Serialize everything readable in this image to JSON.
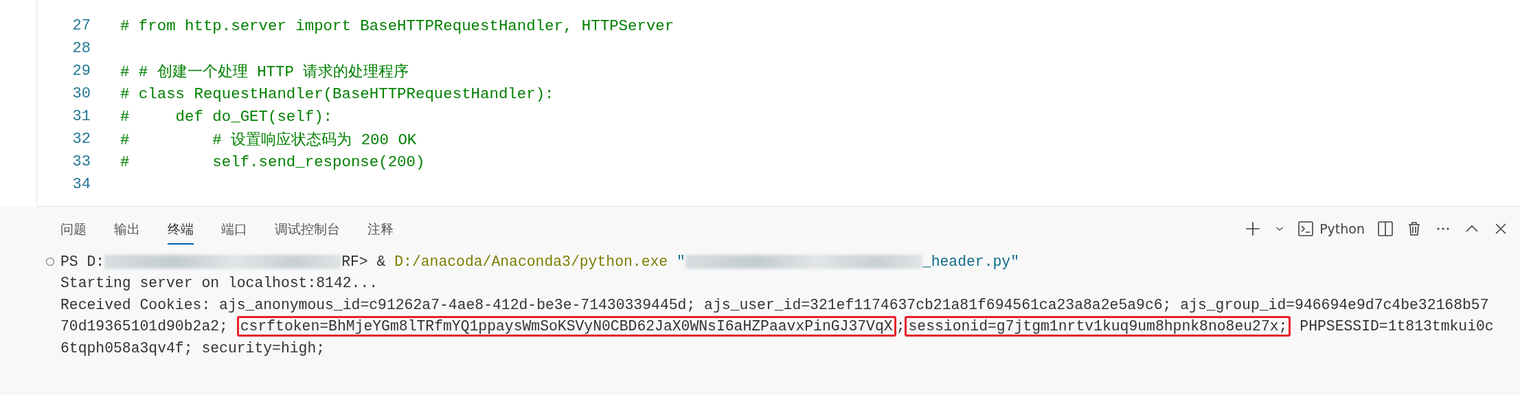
{
  "editor": {
    "lines": [
      {
        "number": "27",
        "text": "# from http.server import BaseHTTPRequestHandler, HTTPServer"
      },
      {
        "number": "28"
      },
      {
        "number": "29",
        "text": "# # 创建一个处理 HTTP 请求的处理程序"
      },
      {
        "number": "30",
        "text": "# class RequestHandler(BaseHTTPRequestHandler):"
      },
      {
        "number": "31",
        "text": "#     def do_GET(self):"
      },
      {
        "number": "32",
        "text": "#         # 设置响应状态码为 200 OK"
      },
      {
        "number": "33",
        "text": "#         self.send_response(200)"
      },
      {
        "number": "34"
      }
    ]
  },
  "panel": {
    "tabs": [
      {
        "label": "问题",
        "selected": false
      },
      {
        "label": "输出",
        "selected": false
      },
      {
        "label": "终端",
        "selected": true
      },
      {
        "label": "端口",
        "selected": false
      },
      {
        "label": "调试控制台",
        "selected": false
      },
      {
        "label": "注释",
        "selected": false
      }
    ],
    "terminal_profile": "Python"
  },
  "terminal": {
    "lines": [
      {
        "kind": "command",
        "segments": [
          {
            "kind": "plain",
            "text": "PS D:"
          },
          {
            "kind": "redacted"
          },
          {
            "kind": "plain",
            "text": "RF> & "
          },
          {
            "kind": "path",
            "text": "D:/anacoda/Anaconda3/python.exe"
          },
          {
            "kind": "string",
            "text": " \""
          },
          {
            "kind": "redacted"
          },
          {
            "kind": "string",
            "text": "_header.py\""
          }
        ]
      },
      {
        "kind": "output",
        "segments": [
          {
            "kind": "plain",
            "text": "Starting server on localhost:8142..."
          }
        ]
      },
      {
        "kind": "output",
        "segments": [
          {
            "kind": "plain",
            "text": "Received Cookies: ajs_anonymous_id=c91262a7-4ae8-412d-be3e-71430339445d; ajs_user_id=321ef1174637cb21a81f694561ca23a8a2e5a9c6; ajs_group_id=946694e9d7c4be32168b57"
          }
        ]
      },
      {
        "kind": "output",
        "segments": [
          {
            "kind": "plain",
            "text": "70d19365101d90b2a2; "
          },
          {
            "kind": "highlight",
            "text": "csrftoken=BhMjeYGm8lTRfmYQ1ppaysWmSoKSVyN0CBD62JaX0WNsI6aHZPaavxPinGJ37VqX"
          },
          {
            "kind": "plain",
            "text": ";"
          },
          {
            "kind": "highlight",
            "text": "sessionid=g7jtgm1nrtv1kuq9um8hpnk8no8eu27x;"
          },
          {
            "kind": "plain",
            "text": " PHPSESSID=1t813tmkui0c"
          }
        ]
      },
      {
        "kind": "output",
        "segments": [
          {
            "kind": "plain",
            "text": "6tqph058a3qv4f; security=high;"
          }
        ]
      }
    ]
  }
}
